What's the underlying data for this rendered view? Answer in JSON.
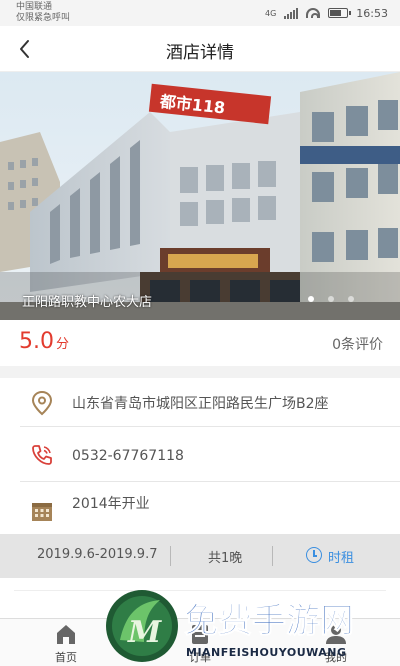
{
  "status_bar": {
    "carrier_line1": "中国联通",
    "carrier_line2": "仅限紧急呼叫",
    "network": "4G",
    "time": "16:53"
  },
  "nav": {
    "title": "酒店详情",
    "back_icon": "chevron-left-icon"
  },
  "banner": {
    "caption": "正阳路职教中心农大店",
    "sign_text": "都市118",
    "slide_count": 3,
    "active_slide": 1
  },
  "rating": {
    "score": "5.0",
    "unit": "分",
    "reviews": "0条评价",
    "score_color": "#e23b2e"
  },
  "info": {
    "address": "山东省青岛市城阳区正阳路民生广场B2座",
    "phone": "0532-67767118",
    "opened": "2014年开业",
    "address_icon": "location-pin-icon",
    "phone_icon": "phone-icon",
    "opened_icon": "calendar-icon"
  },
  "booking": {
    "dates": "2019.9.6-2019.9.7",
    "nights": "共1晚",
    "hourly": "时租",
    "hourly_icon": "clock-icon",
    "accent": "#3b8fe0"
  },
  "bottom_nav": {
    "tabs": [
      {
        "label": "首页",
        "icon": "home-icon"
      },
      {
        "label": "订单",
        "icon": "order-icon"
      },
      {
        "label": "我的",
        "icon": "user-icon"
      }
    ]
  },
  "watermark": {
    "title": "免费手游网",
    "subtitle": "MIANFEISHOUYOUWANG"
  }
}
